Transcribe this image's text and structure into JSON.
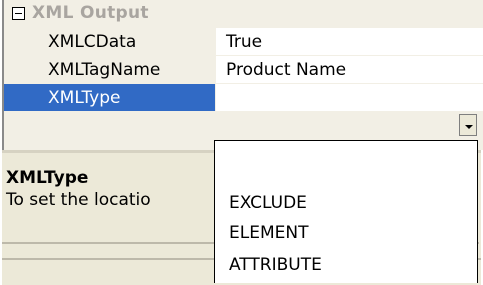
{
  "category": {
    "label": "XML Output"
  },
  "properties": [
    {
      "name": "XMLCData",
      "value": "True"
    },
    {
      "name": "XMLTagName",
      "value": "Product Name"
    },
    {
      "name": "XMLType",
      "value": ""
    }
  ],
  "description": {
    "title": "XMLType",
    "text": "To set the locatio"
  },
  "dropdown": {
    "options": [
      "",
      "EXCLUDE",
      "ELEMENT",
      "ATTRIBUTE"
    ]
  },
  "icons": {
    "expander": "collapse-minus-icon",
    "dropdown": "chevron-down-icon"
  }
}
